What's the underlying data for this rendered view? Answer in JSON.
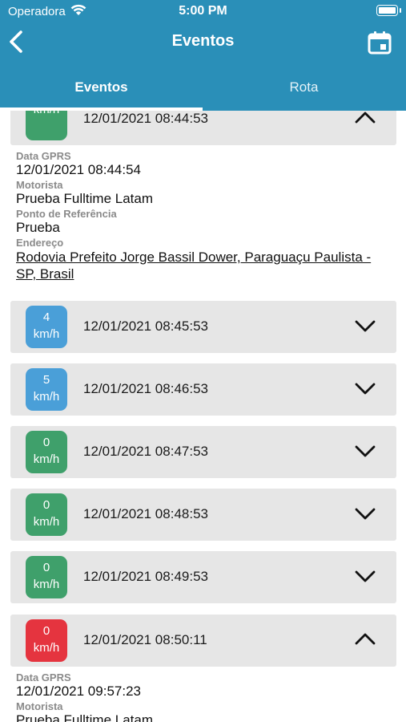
{
  "status_bar": {
    "carrier": "Operadora",
    "time": "5:00 PM"
  },
  "nav": {
    "title": "Eventos"
  },
  "tabs": [
    {
      "label": "Eventos",
      "active": true
    },
    {
      "label": "Rota",
      "active": false
    }
  ],
  "colors": {
    "header": "#2a8fb8",
    "green": "#3fa06b",
    "blue": "#4a9fd8",
    "red": "#e5343f"
  },
  "events": [
    {
      "speed": "",
      "unit": "km/h",
      "time": "12/01/2021 08:44:53",
      "color": "#3fa06b",
      "expanded": true,
      "details": {
        "gprs_label": "Data GPRS",
        "gprs_value": "12/01/2021 08:44:54",
        "driver_label": "Motorista",
        "driver_value": "Prueba Fulltime Latam",
        "ref_label": "Ponto de Referência",
        "ref_value": "Prueba",
        "address_label": "Endereço",
        "address_value": "Rodovia Prefeito Jorge Bassil Dower, Paraguaçu Paulista - SP, Brasil"
      }
    },
    {
      "speed": "4",
      "unit": "km/h",
      "time": "12/01/2021 08:45:53",
      "color": "#4a9fd8",
      "expanded": false
    },
    {
      "speed": "5",
      "unit": "km/h",
      "time": "12/01/2021 08:46:53",
      "color": "#4a9fd8",
      "expanded": false
    },
    {
      "speed": "0",
      "unit": "km/h",
      "time": "12/01/2021 08:47:53",
      "color": "#3fa06b",
      "expanded": false
    },
    {
      "speed": "0",
      "unit": "km/h",
      "time": "12/01/2021 08:48:53",
      "color": "#3fa06b",
      "expanded": false
    },
    {
      "speed": "0",
      "unit": "km/h",
      "time": "12/01/2021 08:49:53",
      "color": "#3fa06b",
      "expanded": false
    },
    {
      "speed": "0",
      "unit": "km/h",
      "time": "12/01/2021 08:50:11",
      "color": "#e5343f",
      "expanded": true,
      "details": {
        "gprs_label": "Data GPRS",
        "gprs_value": "12/01/2021 09:57:23",
        "driver_label": "Motorista",
        "driver_value": "Prueba Fulltime Latam"
      }
    }
  ]
}
